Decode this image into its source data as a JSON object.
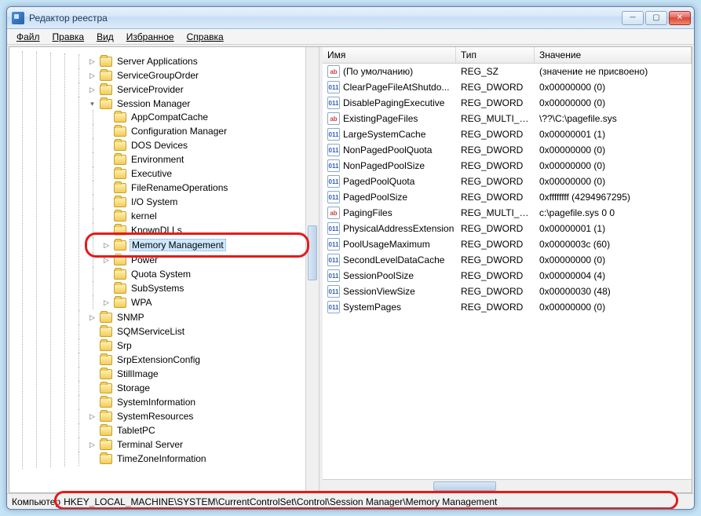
{
  "window_title": "Редактор реестра",
  "menu": {
    "file": "Файл",
    "edit": "Правка",
    "view": "Вид",
    "favorites": "Избранное",
    "help": "Справка"
  },
  "columns": {
    "name": "Имя",
    "type": "Тип",
    "data": "Значение"
  },
  "tree": {
    "top_siblings": [
      "Server Applications",
      "ServiceGroupOrder",
      "ServiceProvider"
    ],
    "session_manager_label": "Session Manager",
    "session_manager_children": [
      {
        "label": "AppCompatCache",
        "exp": ""
      },
      {
        "label": "Configuration Manager",
        "exp": ""
      },
      {
        "label": "DOS Devices",
        "exp": ""
      },
      {
        "label": "Environment",
        "exp": ""
      },
      {
        "label": "Executive",
        "exp": ""
      },
      {
        "label": "FileRenameOperations",
        "exp": ""
      },
      {
        "label": "I/O System",
        "exp": ""
      },
      {
        "label": "kernel",
        "exp": ""
      },
      {
        "label": "KnownDLLs",
        "exp": ""
      },
      {
        "label": "Memory Management",
        "exp": "▷",
        "selected": true
      },
      {
        "label": "Power",
        "exp": "▷"
      },
      {
        "label": "Quota System",
        "exp": ""
      },
      {
        "label": "SubSystems",
        "exp": ""
      },
      {
        "label": "WPA",
        "exp": "▷"
      }
    ],
    "bottom_siblings": [
      {
        "label": "SNMP",
        "exp": "▷"
      },
      {
        "label": "SQMServiceList",
        "exp": ""
      },
      {
        "label": "Srp",
        "exp": ""
      },
      {
        "label": "SrpExtensionConfig",
        "exp": ""
      },
      {
        "label": "StillImage",
        "exp": ""
      },
      {
        "label": "Storage",
        "exp": ""
      },
      {
        "label": "SystemInformation",
        "exp": ""
      },
      {
        "label": "SystemResources",
        "exp": "▷"
      },
      {
        "label": "TabletPC",
        "exp": ""
      },
      {
        "label": "Terminal Server",
        "exp": "▷"
      },
      {
        "label": "TimeZoneInformation",
        "exp": ""
      }
    ]
  },
  "values": [
    {
      "icon": "ab",
      "name": "(По умолчанию)",
      "type": "REG_SZ",
      "data": "(значение не присвоено)"
    },
    {
      "icon": "011",
      "name": "ClearPageFileAtShutdo...",
      "type": "REG_DWORD",
      "data": "0x00000000 (0)"
    },
    {
      "icon": "011",
      "name": "DisablePagingExecutive",
      "type": "REG_DWORD",
      "data": "0x00000000 (0)"
    },
    {
      "icon": "ab",
      "name": "ExistingPageFiles",
      "type": "REG_MULTI_SZ",
      "data": "\\??\\C:\\pagefile.sys"
    },
    {
      "icon": "011",
      "name": "LargeSystemCache",
      "type": "REG_DWORD",
      "data": "0x00000001 (1)"
    },
    {
      "icon": "011",
      "name": "NonPagedPoolQuota",
      "type": "REG_DWORD",
      "data": "0x00000000 (0)"
    },
    {
      "icon": "011",
      "name": "NonPagedPoolSize",
      "type": "REG_DWORD",
      "data": "0x00000000 (0)"
    },
    {
      "icon": "011",
      "name": "PagedPoolQuota",
      "type": "REG_DWORD",
      "data": "0x00000000 (0)"
    },
    {
      "icon": "011",
      "name": "PagedPoolSize",
      "type": "REG_DWORD",
      "data": "0xffffffff (4294967295)"
    },
    {
      "icon": "ab",
      "name": "PagingFiles",
      "type": "REG_MULTI_SZ",
      "data": "c:\\pagefile.sys 0 0"
    },
    {
      "icon": "011",
      "name": "PhysicalAddressExtension",
      "type": "REG_DWORD",
      "data": "0x00000001 (1)"
    },
    {
      "icon": "011",
      "name": "PoolUsageMaximum",
      "type": "REG_DWORD",
      "data": "0x0000003c (60)"
    },
    {
      "icon": "011",
      "name": "SecondLevelDataCache",
      "type": "REG_DWORD",
      "data": "0x00000000 (0)"
    },
    {
      "icon": "011",
      "name": "SessionPoolSize",
      "type": "REG_DWORD",
      "data": "0x00000004 (4)"
    },
    {
      "icon": "011",
      "name": "SessionViewSize",
      "type": "REG_DWORD",
      "data": "0x00000030 (48)"
    },
    {
      "icon": "011",
      "name": "SystemPages",
      "type": "REG_DWORD",
      "data": "0x00000000 (0)"
    }
  ],
  "status": {
    "label": "Компьютер",
    "path": "HKEY_LOCAL_MACHINE\\SYSTEM\\CurrentControlSet\\Control\\Session Manager\\Memory Management"
  }
}
